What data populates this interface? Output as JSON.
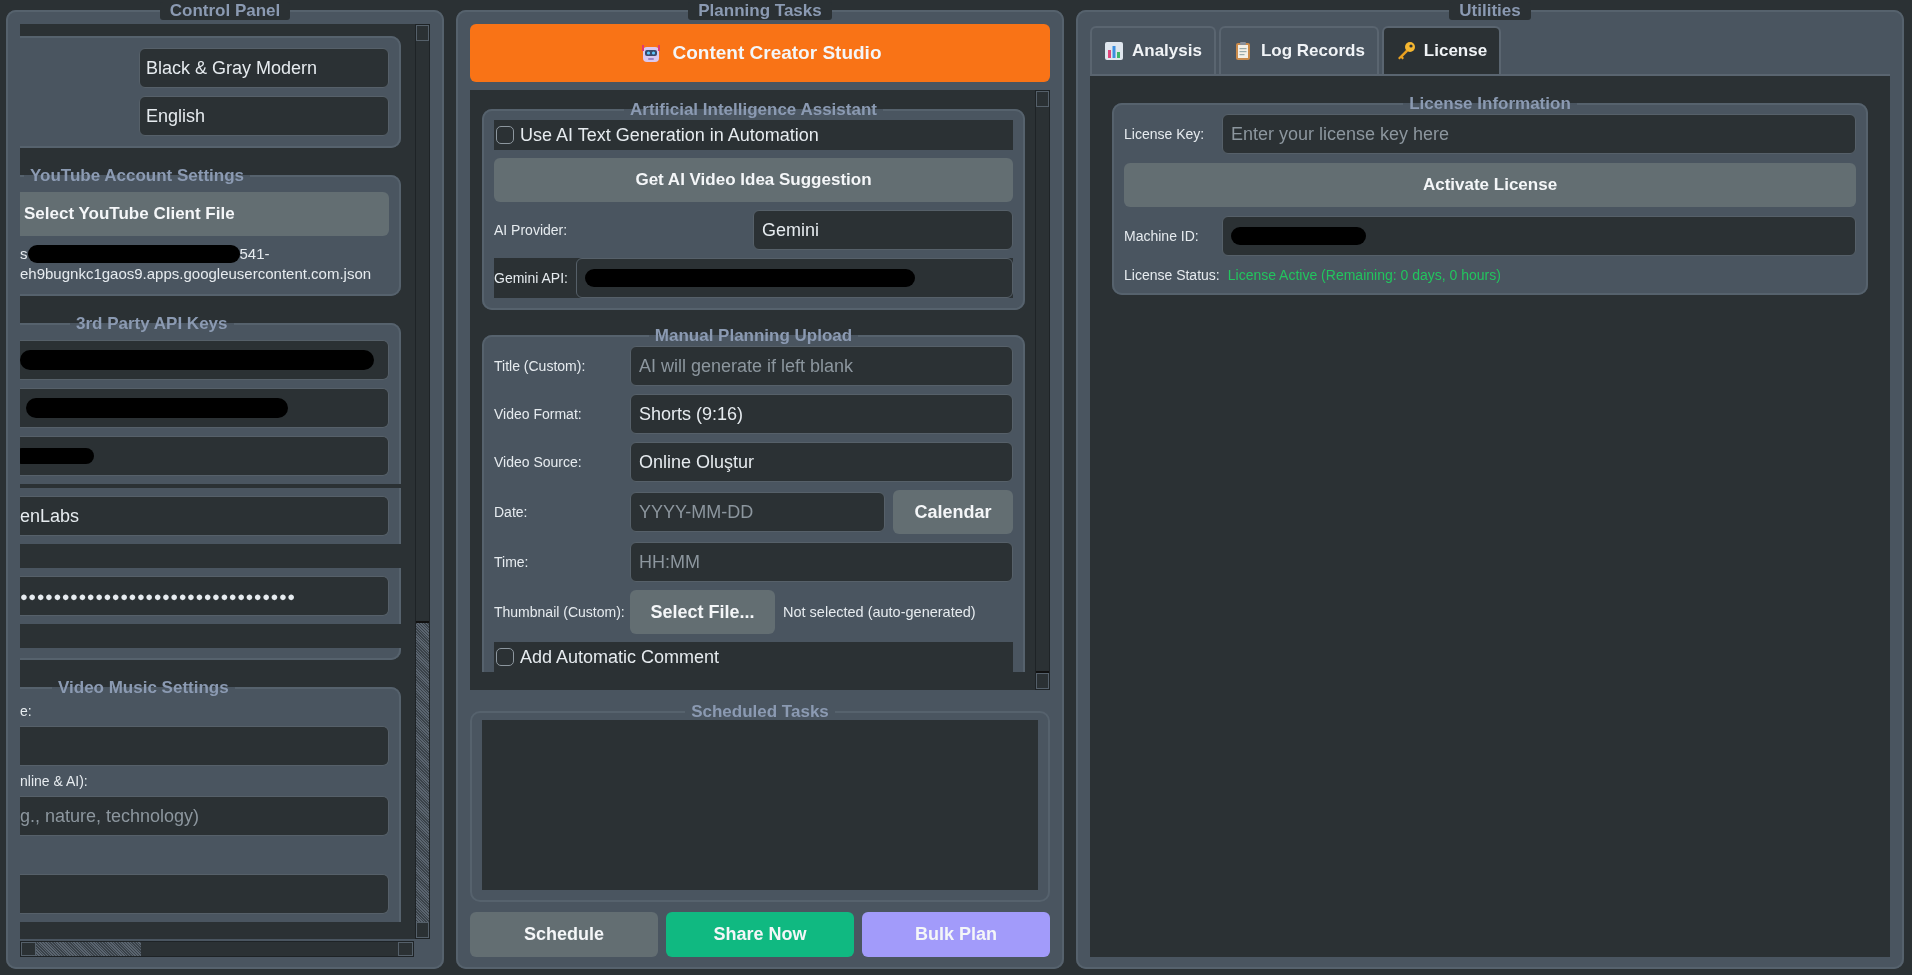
{
  "control_panel": {
    "title": "Control Panel",
    "appearance": [
      {
        "value": "Black & Gray Modern"
      },
      {
        "value": "English"
      }
    ],
    "youtube": {
      "title": "YouTube Account Settings",
      "button": "Select YouTube Client File",
      "path_start": "s",
      "path_end": "541-",
      "path_line2": "eh9bugnkc1gaos9.apps.googleusercontent.com.json",
      "redacted": true
    },
    "api_keys": {
      "title": "3rd Party API Keys",
      "rows": [
        {
          "kind": "redacted"
        },
        {
          "kind": "redacted"
        },
        {
          "kind": "redacted"
        },
        {
          "kind": "text",
          "value": "enLabs"
        },
        {
          "kind": "password",
          "value": "●●●●●●●●●●●●●●●●●●●●●●●●●●●●●●●●●"
        }
      ]
    },
    "music": {
      "title": "Video  Music Settings",
      "rows": [
        {
          "kind": "label",
          "text": "e:"
        },
        {
          "kind": "input"
        },
        {
          "kind": "label",
          "text": "nline & AI):"
        },
        {
          "kind": "input",
          "placeholder": "g., nature, technology)"
        },
        {
          "kind": "gap"
        },
        {
          "kind": "input"
        }
      ]
    }
  },
  "planning": {
    "title": "Planning  Tasks",
    "header_button": "Content Creator Studio",
    "ai": {
      "title": "Artificial Intelligence Assistant",
      "use_ai": {
        "label": "Use AI Text Generation in Automation",
        "checked": false
      },
      "suggest_button": "Get AI Video Idea Suggestion",
      "provider": {
        "label": "AI Provider:",
        "value": "Gemini"
      },
      "api": {
        "label": "Gemini API:",
        "redacted": true
      }
    },
    "manual": {
      "title": "Manual Planning  Upload",
      "rows": [
        {
          "kind": "input",
          "label": "Title (Custom):",
          "placeholder": "AI will generate if left blank"
        },
        {
          "kind": "input",
          "label": "Video Format:",
          "value": "Shorts (9:16)"
        },
        {
          "kind": "input",
          "label": "Video Source:",
          "value": "Online Oluştur"
        },
        {
          "kind": "input_button",
          "label": "Date:",
          "placeholder": "YYYY-MM-DD",
          "button": "Calendar"
        },
        {
          "kind": "input",
          "label": "Time:",
          "placeholder": "HH:MM"
        },
        {
          "kind": "file",
          "label": "Thumbnail (Custom):",
          "button": "Select File...",
          "note": "Not selected (auto-generated)"
        }
      ],
      "comment": {
        "label": "Add Automatic Comment",
        "checked": false
      }
    },
    "scheduled": {
      "title": "Scheduled Tasks"
    },
    "actions": [
      {
        "label": "Schedule",
        "kind": "neutral"
      },
      {
        "label": "Share Now",
        "kind": "primary"
      },
      {
        "label": "Bulk Plan",
        "kind": "accent"
      }
    ]
  },
  "utilities": {
    "title": "Utilities",
    "tabs": [
      {
        "label": "Analysis",
        "selected": false
      },
      {
        "label": "Log Records",
        "selected": false
      },
      {
        "label": "License",
        "selected": true
      }
    ],
    "license": {
      "title": "License Information",
      "key": {
        "label": "License Key:",
        "placeholder": "Enter your license key here"
      },
      "activate_button": "Activate License",
      "machine": {
        "label": "Machine ID:",
        "redacted": true
      },
      "status": {
        "label": "License Status:",
        "value": "License Active (Remaining: 0 days, 0 hours)",
        "active": true
      }
    }
  }
}
